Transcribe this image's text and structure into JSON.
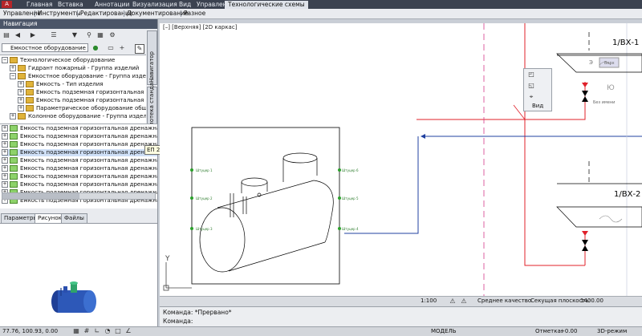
{
  "ribbon": {
    "tabs": [
      "Главная",
      "Вставка",
      "Аннотации",
      "Визуализация",
      "Вид",
      "Управление",
      "Технологические схемы"
    ],
    "active_tab": "Технологические схемы"
  },
  "toolbar": {
    "items": [
      "Управление",
      "Инструменты",
      "Редактирование",
      "Документирование",
      "Разное"
    ]
  },
  "navigator": {
    "title": "Навигация",
    "filter_value": "Емкостное оборудование - Гру...",
    "side_tabs": [
      "Навигатор",
      "Библиотека станда..."
    ],
    "tree": [
      {
        "label": "Технологическое оборудование",
        "level": 0,
        "expanded": true
      },
      {
        "label": "Гидрант пожарный - Группа изделий",
        "level": 1,
        "expanded": false
      },
      {
        "label": "Емкостное оборудование - Группа изделий",
        "level": 1,
        "expanded": true
      },
      {
        "label": "Емкость - Тип изделия",
        "level": 2,
        "expanded": false
      },
      {
        "label": "Емкость подземная горизонтальная дрен",
        "level": 2,
        "expanded": false
      },
      {
        "label": "Емкость подземная горизонтальная дрен",
        "level": 2,
        "expanded": false
      },
      {
        "label": "Параметрическое оборудование общего в",
        "level": 2,
        "expanded": false
      },
      {
        "label": "Колонное оборудование - Группа изделий",
        "level": 1,
        "expanded": false
      }
    ],
    "list": [
      "Емкость подземная горизонтальная дренажная",
      "Емкость подземная горизонтальная дренажна",
      "Емкость подземная горизонтальная дренажна",
      "Емкость подземная горизонтальная дренажная",
      "Емкость подземная горизонтальная дренажна",
      "Емкость подземная горизонтальная дренажна",
      "Емкость подземная горизонтальная дренажна",
      "Емкость подземная горизонтальная дренажна",
      "Емкость подземная горизонтальная дренажна",
      "Емкость подземная горизонтальная дренажна"
    ],
    "tooltip": "ЕП 25-2400-900-1(2)(3)-Т-К",
    "bottom_tabs": [
      "Параметры",
      "Рисунок",
      "Файлы"
    ],
    "active_bottom_tab": "Рисунок"
  },
  "viewport": {
    "label": "[–] [Верхняя] [2D каркас]",
    "view_panel_label": "Вид",
    "nozzles_left": [
      "Штуцер 1",
      "Штуцер 2",
      "Штуцер 3"
    ],
    "nozzles_right": [
      "Штуцер 6",
      "Штуцер 5",
      "Штуцер 4"
    ],
    "diagram_labels": [
      "1/ВХ-1",
      "1/ВХ-2",
      "Э",
      "Верх",
      "Ю",
      "Без имени"
    ],
    "axis_y": "Y",
    "status": {
      "scale": "1:100",
      "quality": "Среднее качество",
      "section_label": "Секущая плоскость:",
      "section_value": "1400.00"
    }
  },
  "command": {
    "line1": "Команда:  *Прервано*",
    "line2": "Команда:"
  },
  "statusbar": {
    "coords": "77.76, 100.93, 0.00",
    "model": "МОДЕЛЬ",
    "elevation_label": "Отметка:",
    "elevation_value": "+0.00",
    "workspace": "3D-режим"
  },
  "colors": {
    "ribbon_bg": "#3b4250",
    "nav_title_bg": "#4b5568",
    "red_line": "#e0202a",
    "blue_line": "#2040a0",
    "equipment_blue": "#2d58b8"
  }
}
